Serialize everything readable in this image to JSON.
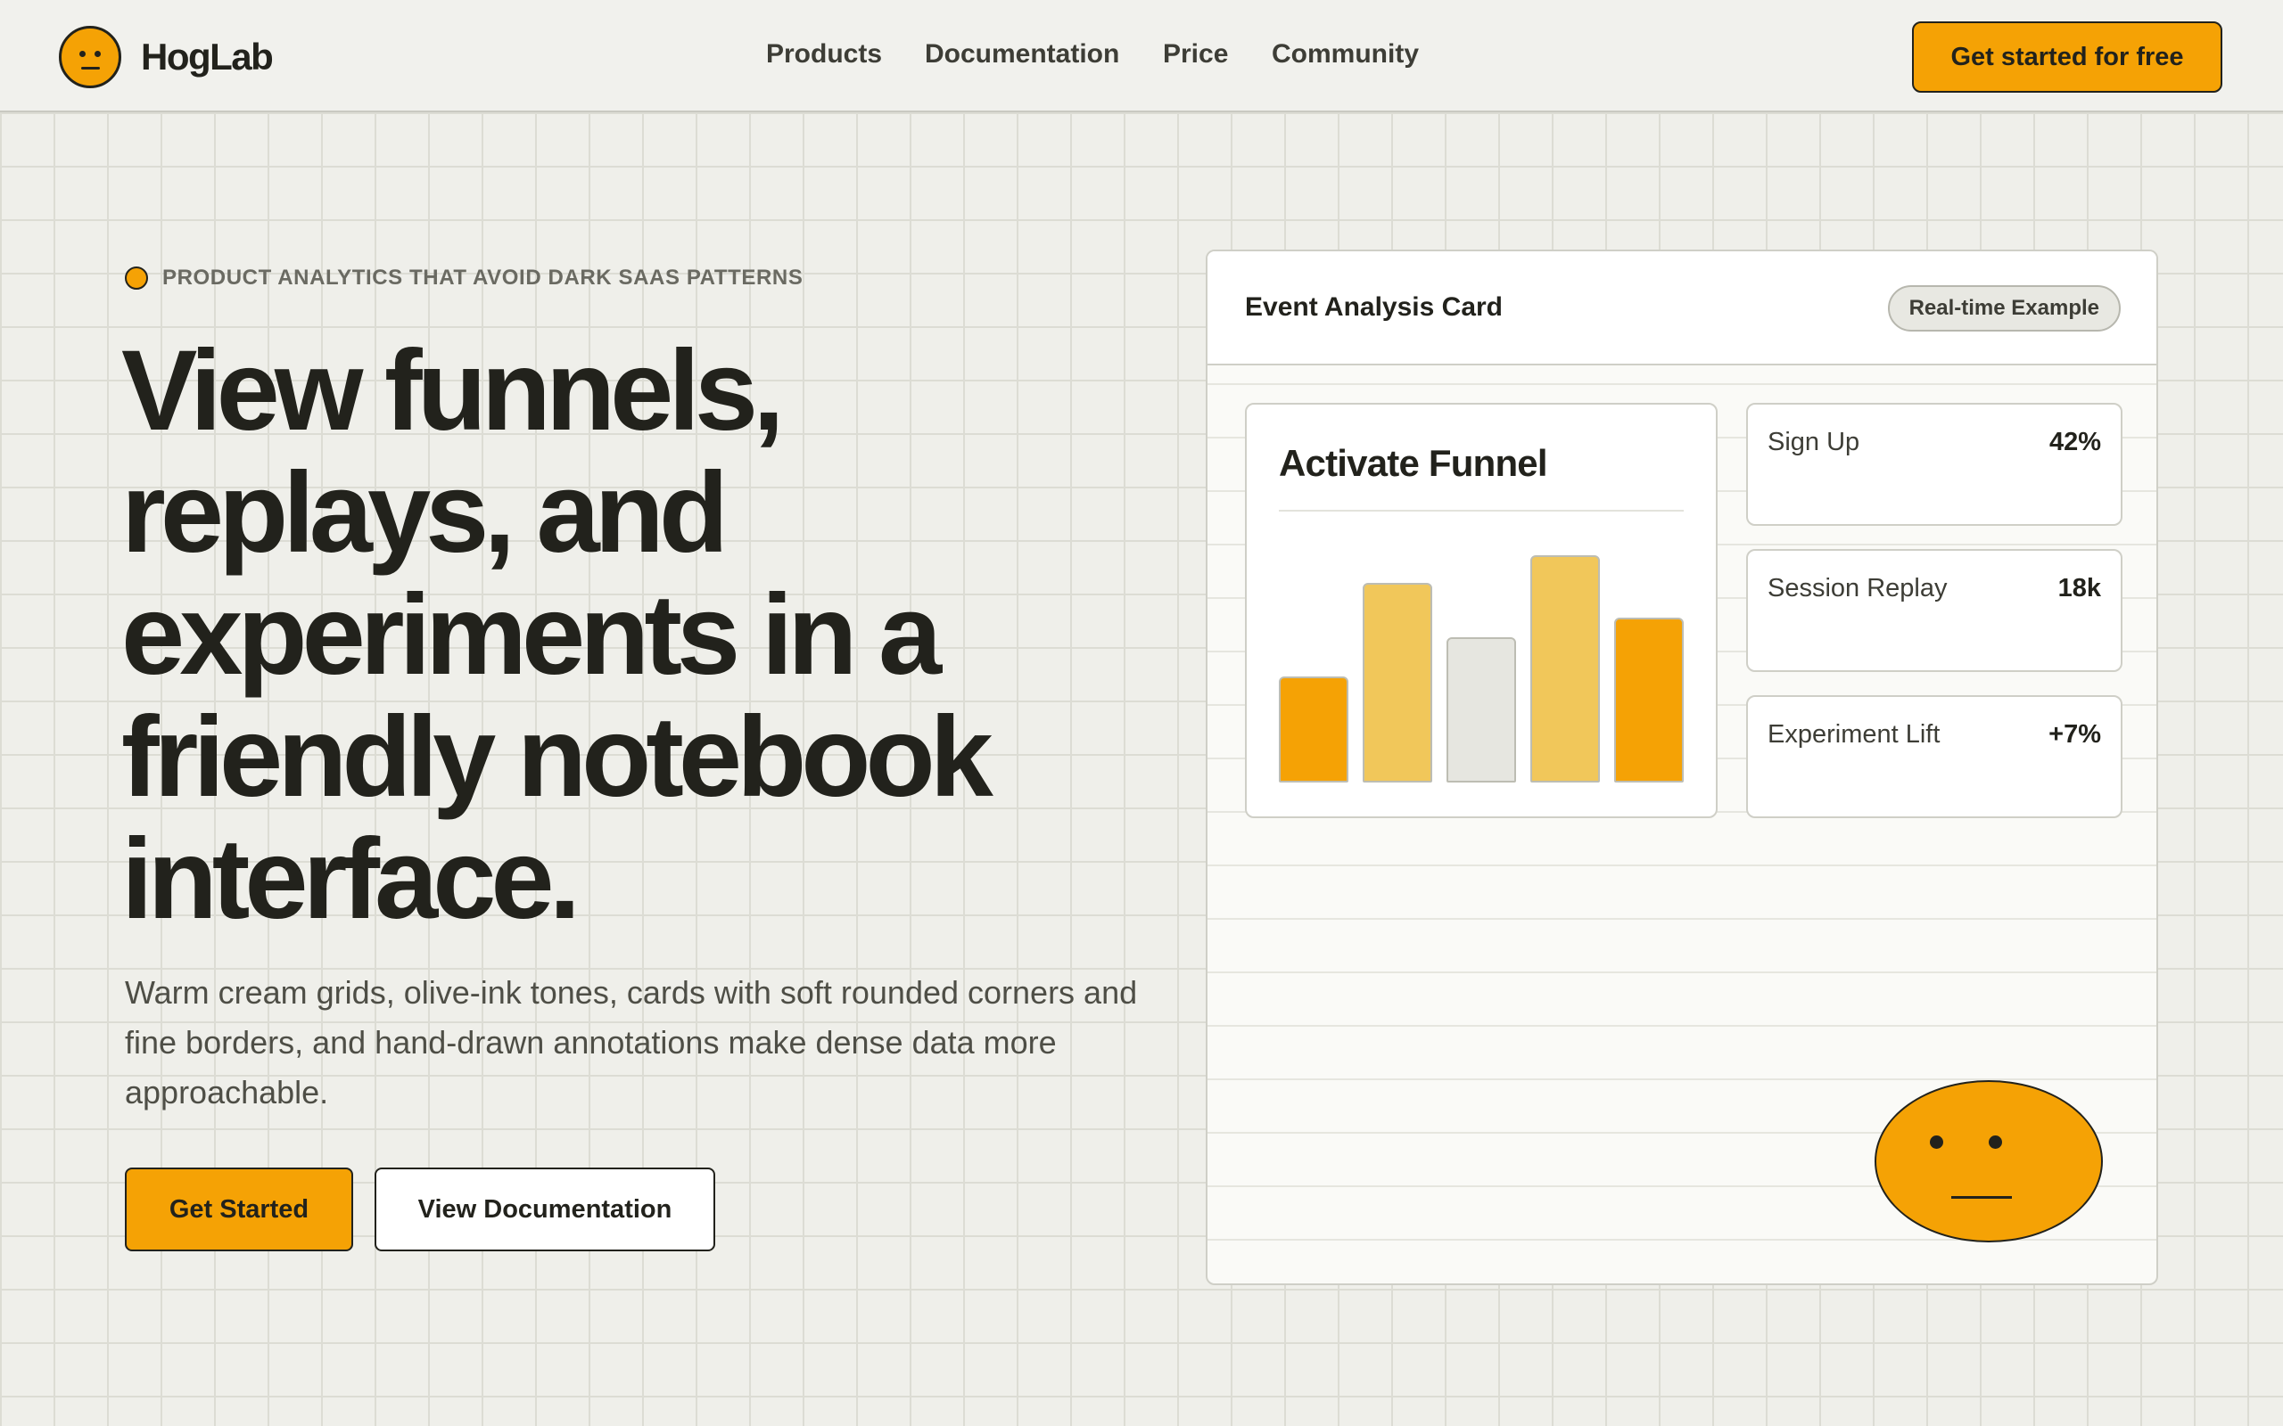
{
  "brand": {
    "name": "HogLab",
    "logo_icon": "neutral-face-icon",
    "accent": "#f5a205",
    "ink": "#22221c"
  },
  "nav": {
    "items": [
      "Products",
      "Documentation",
      "Price",
      "Community"
    ],
    "cta": "Get started for free"
  },
  "hero": {
    "eyebrow": "PRODUCT ANALYTICS THAT AVOID DARK SAAS PATTERNS",
    "headline": "View funnels, replays, and experiments in a friendly notebook interface.",
    "lede": "Warm cream grids, olive-ink tones, cards with soft rounded corners and fine borders, and hand-drawn annotations make dense data more approachable.",
    "primary_button": "Get Started",
    "secondary_button": "View Documentation"
  },
  "card": {
    "title": "Event Analysis Card",
    "badge": "Real-time Example",
    "funnel": {
      "title": "Activate Funnel",
      "bars": [
        {
          "value": 0.27,
          "color": "#f5a205"
        },
        {
          "value": 0.51,
          "color": "#f1c75a"
        },
        {
          "value": 0.37,
          "color": "#e6e6e0"
        },
        {
          "value": 0.58,
          "color": "#f1c75a"
        },
        {
          "value": 0.42,
          "color": "#f5a205"
        }
      ]
    },
    "metrics": [
      {
        "label": "Sign Up",
        "value": "42%"
      },
      {
        "label": "Session Replay",
        "value": "18k"
      },
      {
        "label": "Experiment Lift",
        "value": "+7%"
      }
    ],
    "mascot_icon": "neutral-face-icon"
  }
}
